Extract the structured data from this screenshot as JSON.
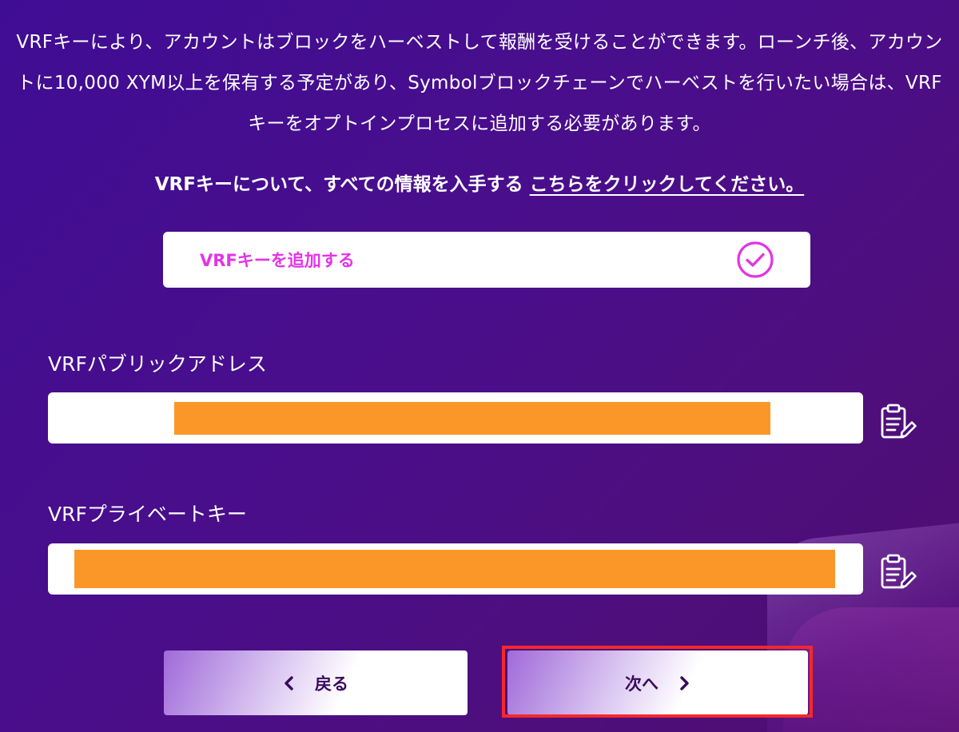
{
  "description": {
    "text": "VRFキーにより、アカウントはブロックをハーベストして報酬を受けることができます。ローンチ後、アカウントに10,000 XYM以上を保有する予定があり、Symbolブロックチェーンでハーベストを行いたい場合は、VRFキーをオプトインプロセスに追加する必要があります。"
  },
  "info": {
    "prefix": "VRFキーについて、すべての情報を入手する",
    "link_label": "こちらをクリックしてください。"
  },
  "add_vrf": {
    "label": "VRFキーを追加する",
    "checked": true,
    "check_icon": "check-circle-icon",
    "accent_color": "#e234e6"
  },
  "public_address": {
    "label": "VRFパブリックアドレス",
    "value_redacted": true,
    "copy_icon": "clipboard-edit-icon"
  },
  "private_key": {
    "label": "VRFプライベートキー",
    "value_redacted": true,
    "copy_icon": "clipboard-edit-icon"
  },
  "nav": {
    "back_label": "戻る",
    "next_label": "次へ",
    "back_icon": "chevron-left-icon",
    "next_icon": "chevron-right-icon"
  },
  "colors": {
    "redaction": "#fb9728",
    "highlight": "#f5282b",
    "button_text": "#3a0a5c"
  }
}
